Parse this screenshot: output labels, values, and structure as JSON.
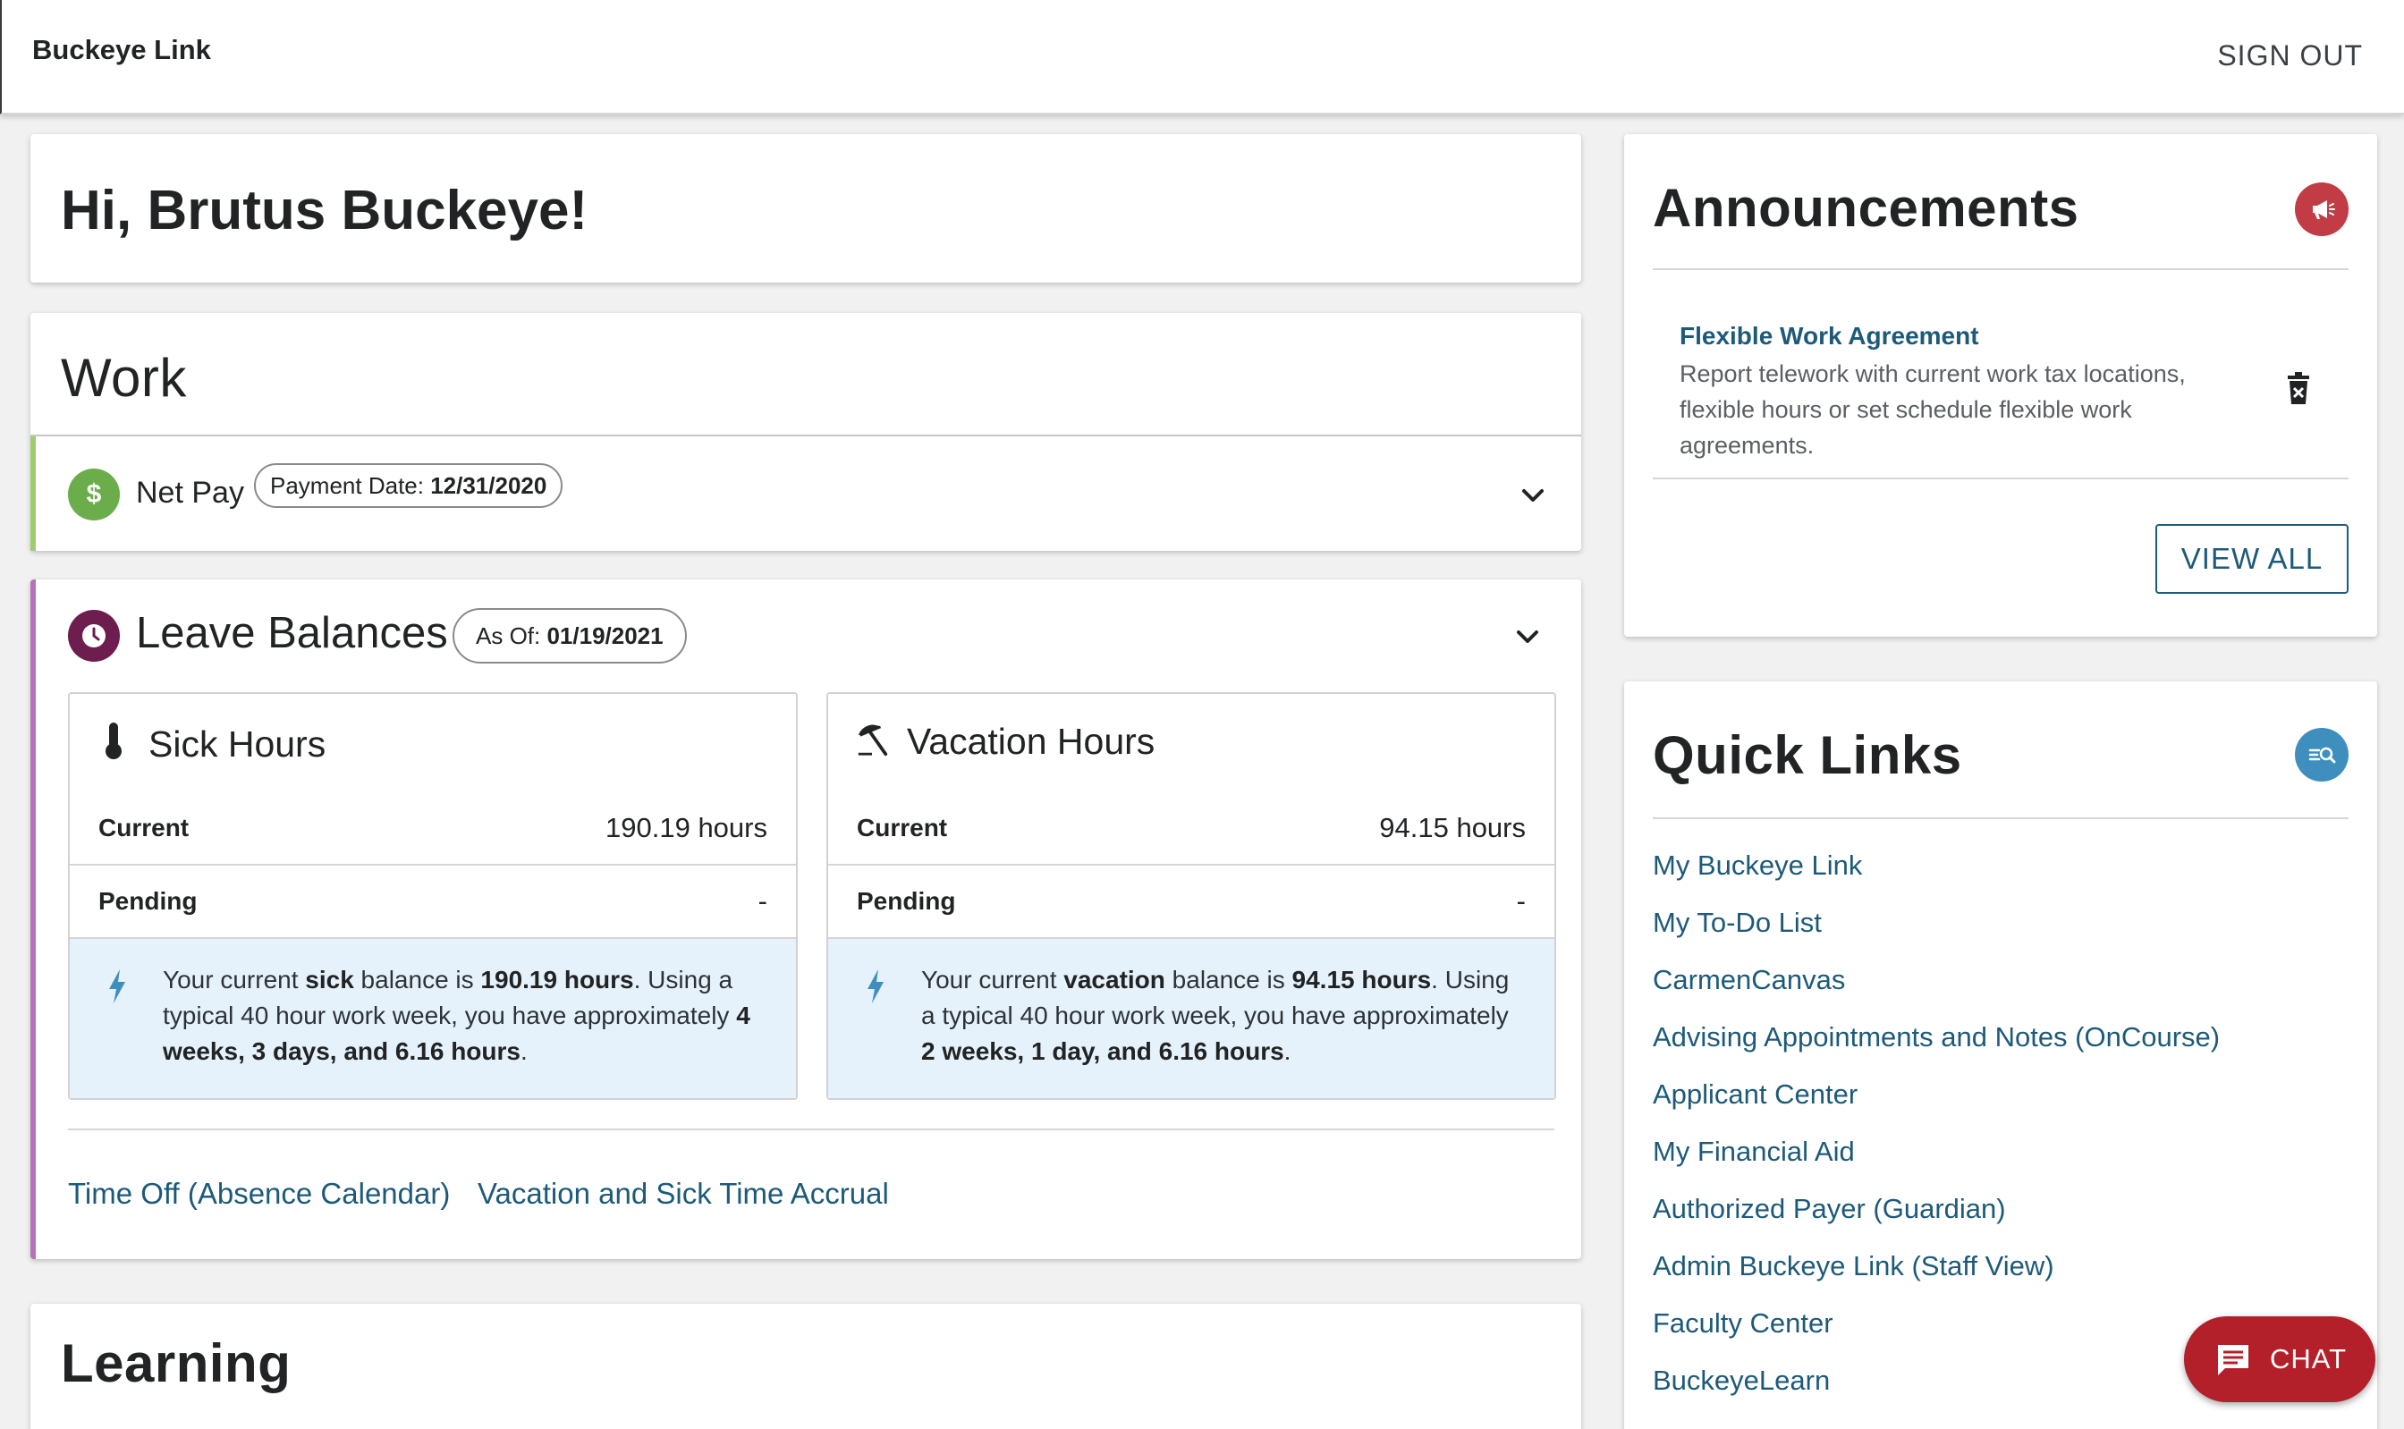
{
  "header": {
    "brand": "Buckeye Link",
    "sign_out": "SIGN OUT"
  },
  "greeting": "Hi, Brutus Buckeye!",
  "work": {
    "title": "Work",
    "net_pay": {
      "label": "Net Pay",
      "icon": "dollar-icon",
      "payment_date_label": "Payment Date: ",
      "payment_date": "12/31/2020"
    }
  },
  "leave": {
    "title": "Leave Balances",
    "icon": "clock-icon",
    "as_of_label": "As Of: ",
    "as_of": "01/19/2021",
    "sick": {
      "title": "Sick Hours",
      "icon": "thermometer-icon",
      "current_label": "Current",
      "current_value": "190.19 hours",
      "pending_label": "Pending",
      "pending_value": "-",
      "info": {
        "p1": "Your current ",
        "b1": "sick",
        "p2": " balance is ",
        "b2": "190.19 hours",
        "p3": ". Using a typical 40 hour work week, you have approximately ",
        "b3": "4 weeks, 3 days, and 6.16 hours",
        "p4": "."
      }
    },
    "vacation": {
      "title": "Vacation Hours",
      "icon": "beach-umbrella-icon",
      "current_label": "Current",
      "current_value": "94.15 hours",
      "pending_label": "Pending",
      "pending_value": "-",
      "info": {
        "p1": "Your current ",
        "b1": "vacation",
        "p2": " balance is ",
        "b2": "94.15 hours",
        "p3": ". Using a typical 40 hour work week, you have approximately ",
        "b3": "2 weeks, 1 day, and 6.16 hours",
        "p4": "."
      }
    },
    "links": [
      "Time Off (Absence Calendar)",
      "Vacation and Sick Time Accrual"
    ]
  },
  "learning": {
    "title": "Learning"
  },
  "announcements": {
    "title": "Announcements",
    "icon": "megaphone-icon",
    "items": [
      {
        "title": "Flexible Work Agreement",
        "description": "Report telework with current work tax locations, flexible hours or set schedule flexible work agreements."
      }
    ],
    "view_all": "VIEW ALL"
  },
  "quick_links": {
    "title": "Quick Links",
    "icon": "search-list-icon",
    "items": [
      "My Buckeye Link",
      "My To-Do List",
      "CarmenCanvas",
      "Advising Appointments and Notes (OnCourse)",
      "Applicant Center",
      "My Financial Aid",
      "Authorized Payer (Guardian)",
      "Admin Buckeye Link (Staff View)",
      "Faculty Center",
      "BuckeyeLearn"
    ]
  },
  "chat": {
    "label": "CHAT",
    "icon": "chat-icon"
  },
  "colors": {
    "link": "#1d5a7a",
    "net_pay_accent": "#9ecc6e",
    "leave_accent": "#b771b9",
    "chat_bg": "#b3202a",
    "info_bg": "#e6f2fb"
  }
}
